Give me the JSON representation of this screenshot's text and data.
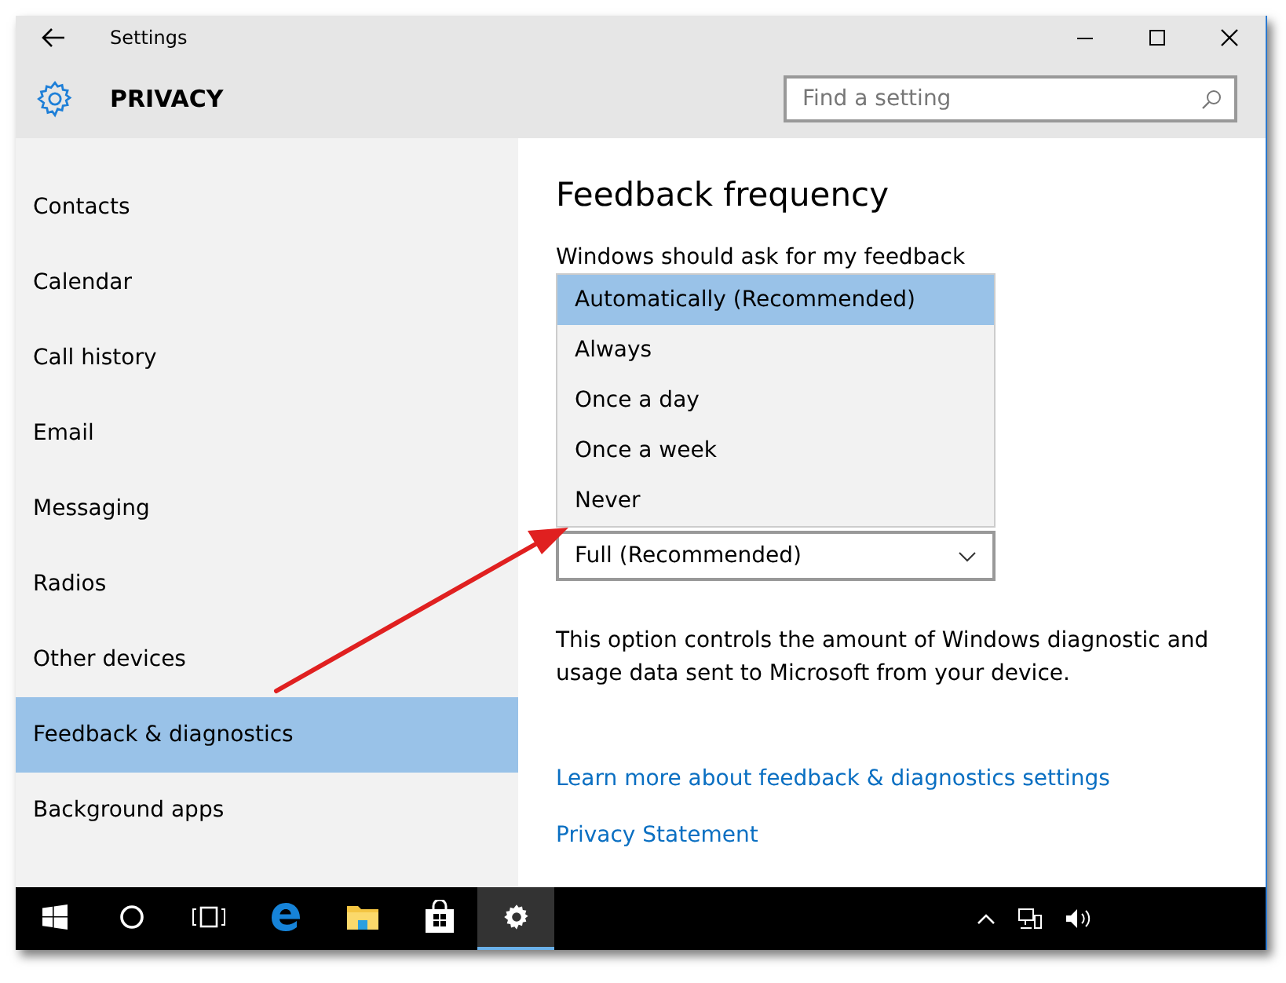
{
  "window": {
    "title": "Settings"
  },
  "header": {
    "title": "PRIVACY",
    "search": {
      "placeholder": "Find a setting"
    }
  },
  "sidebar": {
    "items": [
      {
        "label": "Contacts",
        "selected": false
      },
      {
        "label": "Calendar",
        "selected": false
      },
      {
        "label": "Call history",
        "selected": false
      },
      {
        "label": "Email",
        "selected": false
      },
      {
        "label": "Messaging",
        "selected": false
      },
      {
        "label": "Radios",
        "selected": false
      },
      {
        "label": "Other devices",
        "selected": false
      },
      {
        "label": "Feedback & diagnostics",
        "selected": true
      },
      {
        "label": "Background apps",
        "selected": false
      }
    ]
  },
  "content": {
    "heading": "Feedback frequency",
    "feedback_label": "Windows should ask for my feedback",
    "dropdown_options": [
      {
        "label": "Automatically (Recommended)",
        "selected": true
      },
      {
        "label": "Always",
        "selected": false
      },
      {
        "label": "Once a day",
        "selected": false
      },
      {
        "label": "Once a week",
        "selected": false
      },
      {
        "label": "Never",
        "selected": false
      }
    ],
    "diagnostic_value": "Full (Recommended)",
    "description": "This option controls the amount of Windows diagnostic and usage data sent to Microsoft from your device.",
    "links": [
      "Learn more about feedback & diagnostics settings",
      "Privacy Statement"
    ]
  },
  "taskbar": {
    "apps": [
      {
        "kind": "start",
        "selected": false
      },
      {
        "kind": "search",
        "selected": false
      },
      {
        "kind": "taskview",
        "selected": false
      },
      {
        "kind": "browser",
        "selected": false
      },
      {
        "kind": "folder",
        "selected": false
      },
      {
        "kind": "store",
        "selected": false
      },
      {
        "kind": "settings",
        "selected": true
      }
    ],
    "tray": [
      {
        "kind": "chevron"
      },
      {
        "kind": "network"
      },
      {
        "kind": "volume"
      }
    ]
  }
}
